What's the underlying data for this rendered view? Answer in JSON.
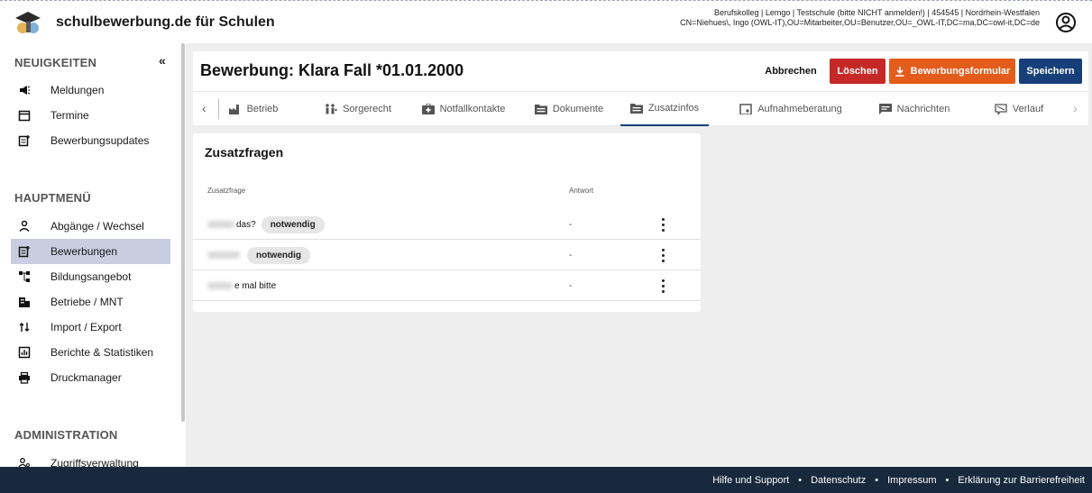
{
  "app": {
    "title": "schulbewerbung.de für Schulen",
    "user_line1": "Berufskolleg | Lemgo | Testschule (bitte NICHT anmelden!) | 454545 | Nordrhein-Westfalen",
    "user_line2": "CN=Niehues\\, Ingo (OWL-IT),OU=Mitarbeiter,OU=Benutzer,OU=_OWL-IT,DC=ma,DC=owl-it,DC=de",
    "account_icon": "account-circle-icon"
  },
  "sidebar": {
    "collapse_label": "«",
    "news_heading": "NEUIGKEITEN",
    "news_items": [
      {
        "label": "Meldungen",
        "icon": "megaphone-icon"
      },
      {
        "label": "Termine",
        "icon": "calendar-icon"
      },
      {
        "label": "Bewerbungsupdates",
        "icon": "document-update-icon"
      }
    ],
    "main_heading": "HAUPTMENÜ",
    "main_items": [
      {
        "label": "Abgänge / Wechsel",
        "icon": "person-icon"
      },
      {
        "label": "Bewerbungen",
        "icon": "document-update-icon",
        "active": true
      },
      {
        "label": "Bildungsangebot",
        "icon": "hierarchy-icon"
      },
      {
        "label": "Betriebe / MNT",
        "icon": "building-icon"
      },
      {
        "label": "Import / Export",
        "icon": "import-export-icon"
      },
      {
        "label": "Berichte & Statistiken",
        "icon": "chart-icon"
      },
      {
        "label": "Druckmanager",
        "icon": "printer-icon"
      }
    ],
    "admin_heading": "ADMINISTRATION",
    "admin_items": [
      {
        "label": "Zugriffsverwaltung",
        "icon": "people-key-icon"
      }
    ]
  },
  "page": {
    "title": "Bewerbung: Klara Fall *01.01.2000",
    "cancel_label": "Abbrechen",
    "delete_label": "Löschen",
    "form_label": "Bewerbungsformular",
    "save_label": "Speichern"
  },
  "tabs": [
    {
      "label": "Betrieb",
      "icon": "factory-icon"
    },
    {
      "label": "Sorgerecht",
      "icon": "family-icon"
    },
    {
      "label": "Notfallkontakte",
      "icon": "medical-kit-icon"
    },
    {
      "label": "Dokumente",
      "icon": "folder-icon"
    },
    {
      "label": "Zusatzinfos",
      "icon": "folder-icon",
      "active": true
    },
    {
      "label": "Aufnahmeberatung",
      "icon": "calendar-event-icon"
    },
    {
      "label": "Nachrichten",
      "icon": "message-icon"
    },
    {
      "label": "Verlauf",
      "icon": "history-icon"
    }
  ],
  "questions": {
    "title": "Zusatzfragen",
    "col_question": "Zusatzfrage",
    "col_answer": "Antwort",
    "rows": [
      {
        "question_suffix": "das?",
        "badge": "notwendig",
        "answer": "-"
      },
      {
        "question_suffix": "",
        "badge": "notwendig",
        "answer": "-"
      },
      {
        "question_suffix": "e mal bitte",
        "badge": "",
        "answer": "-"
      }
    ]
  },
  "footer": {
    "links": [
      "Hilfe und Support",
      "Datenschutz",
      "Impressum",
      "Erklärung zur Barrierefreiheit"
    ],
    "separator": "•"
  },
  "colors": {
    "accent": "#173f7a",
    "delete": "#c62828",
    "form": "#e35c1c",
    "footer": "#18283d",
    "active_nav": "#c8cde0"
  }
}
